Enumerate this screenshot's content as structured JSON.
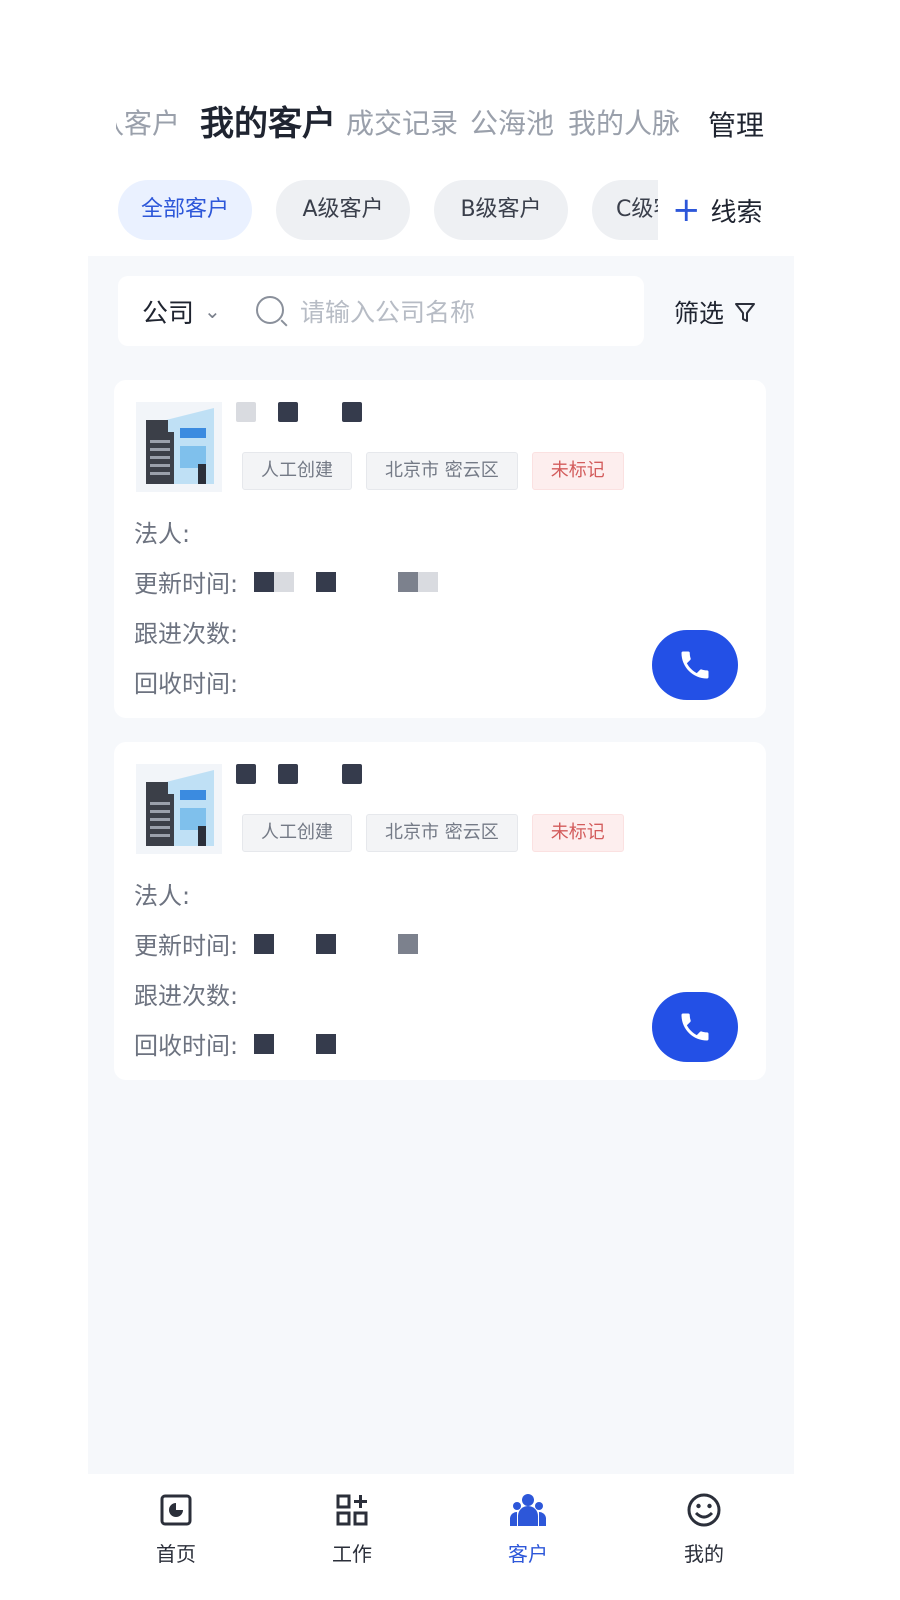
{
  "top_tabs": {
    "items": [
      "团队客户",
      "我的客户",
      "成交记录",
      "公海池",
      "我的人脉"
    ],
    "active_index": 1,
    "manage_label": "管理"
  },
  "chips": {
    "items": [
      "全部客户",
      "A级客户",
      "B级客户",
      "C级客户"
    ],
    "active_index": 0,
    "add_label": "线索"
  },
  "search": {
    "type_label": "公司",
    "placeholder": "请输入公司名称",
    "filter_label": "筛选"
  },
  "cards": [
    {
      "tags": [
        "人工创建",
        "北京市 密云区",
        "未标记"
      ],
      "fields": {
        "legal_person": "法人:",
        "updated": "更新时间:",
        "follow_count": "跟进次数:",
        "recycle": "回收时间:"
      }
    },
    {
      "tags": [
        "人工创建",
        "北京市 密云区",
        "未标记"
      ],
      "fields": {
        "legal_person": "法人:",
        "updated": "更新时间:",
        "follow_count": "跟进次数:",
        "recycle": "回收时间:"
      }
    }
  ],
  "bottom_nav": {
    "items": [
      "首页",
      "工作",
      "客户",
      "我的"
    ],
    "active_index": 2
  },
  "colors": {
    "accent": "#2350e6",
    "tag_red": "#d35c5c",
    "panel_bg": "#f6f8fb"
  },
  "icons": [
    "search-icon",
    "chevron-down-icon",
    "filter-icon",
    "plus-icon",
    "phone-icon",
    "building-icon",
    "dashboard-icon",
    "apps-icon",
    "people-icon",
    "smile-icon"
  ]
}
